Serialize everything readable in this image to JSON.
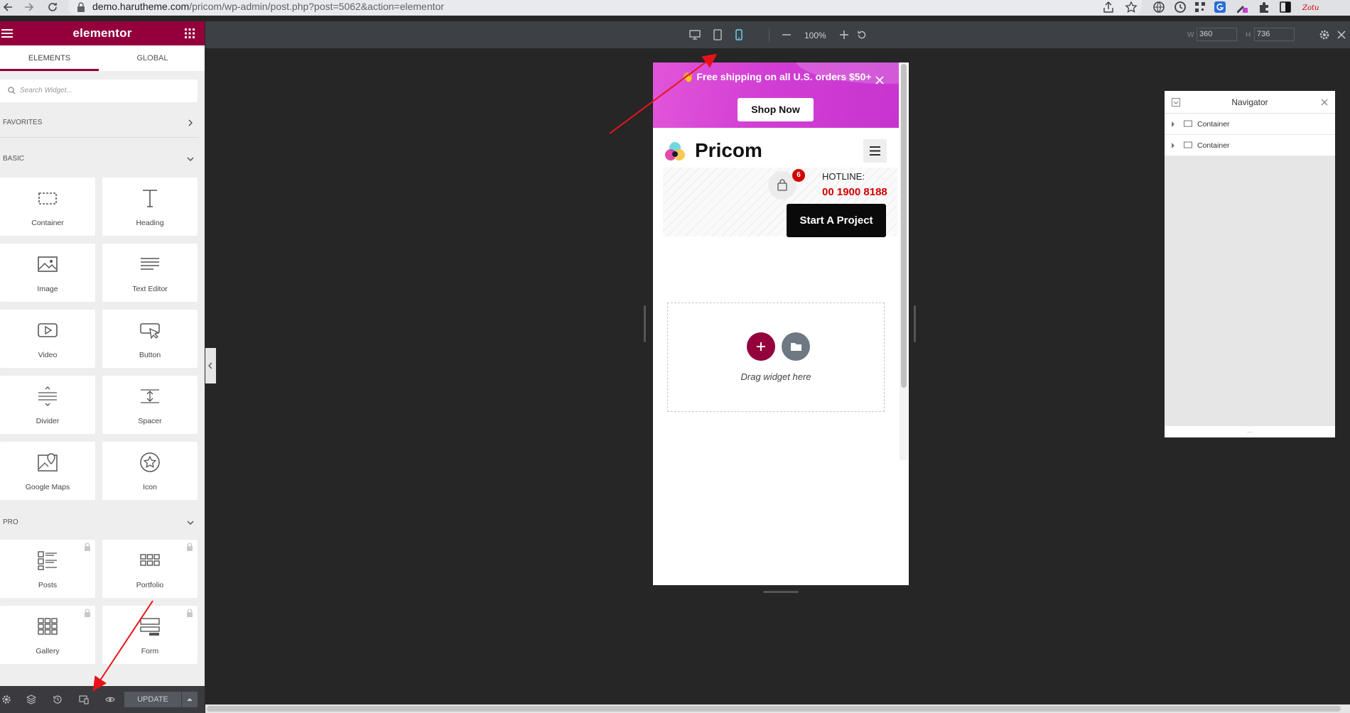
{
  "browser": {
    "url_host": "demo.harutheme.com",
    "url_path": "/pricom/wp-admin/post.php?post=5062&action=elementor"
  },
  "panel": {
    "logo": "elementor",
    "tabs": [
      "ELEMENTS",
      "GLOBAL"
    ],
    "search_placeholder": "Search Widget...",
    "favorites_label": "FAVORITES",
    "basic_label": "BASIC",
    "pro_label": "PRO",
    "basic_widgets": [
      {
        "label": "Container",
        "icon": "container-icon"
      },
      {
        "label": "Heading",
        "icon": "heading-icon"
      },
      {
        "label": "Image",
        "icon": "image-icon"
      },
      {
        "label": "Text Editor",
        "icon": "text-editor-icon"
      },
      {
        "label": "Video",
        "icon": "video-icon"
      },
      {
        "label": "Button",
        "icon": "button-icon"
      },
      {
        "label": "Divider",
        "icon": "divider-icon"
      },
      {
        "label": "Spacer",
        "icon": "spacer-icon"
      },
      {
        "label": "Google Maps",
        "icon": "google-maps-icon"
      },
      {
        "label": "Icon",
        "icon": "star-icon"
      }
    ],
    "pro_widgets": [
      {
        "label": "Posts",
        "icon": "posts-icon"
      },
      {
        "label": "Portfolio",
        "icon": "portfolio-icon"
      },
      {
        "label": "Gallery",
        "icon": "gallery-icon"
      },
      {
        "label": "Form",
        "icon": "form-icon"
      }
    ],
    "update_label": "UPDATE"
  },
  "toolbar": {
    "zoom": "100%",
    "width_label": "W",
    "width_value": "360",
    "height_label": "H",
    "height_value": "736"
  },
  "preview": {
    "promo_text": "👋 Free shipping on all U.S. orders $50+",
    "shop_button": "Shop Now",
    "brand": "Pricom",
    "cart_count": "6",
    "hotline_label": "HOTLINE:",
    "hotline_number": "00 1900 8188",
    "project_button": "Start A Project",
    "drag_text": "Drag widget here"
  },
  "navigator": {
    "title": "Navigator",
    "items": [
      "Container",
      "Container"
    ],
    "footer": "..."
  },
  "colors": {
    "brand": "#93003c",
    "active_device": "#71d7f7",
    "promo": "#d23ed4",
    "hotline": "#d10000"
  }
}
